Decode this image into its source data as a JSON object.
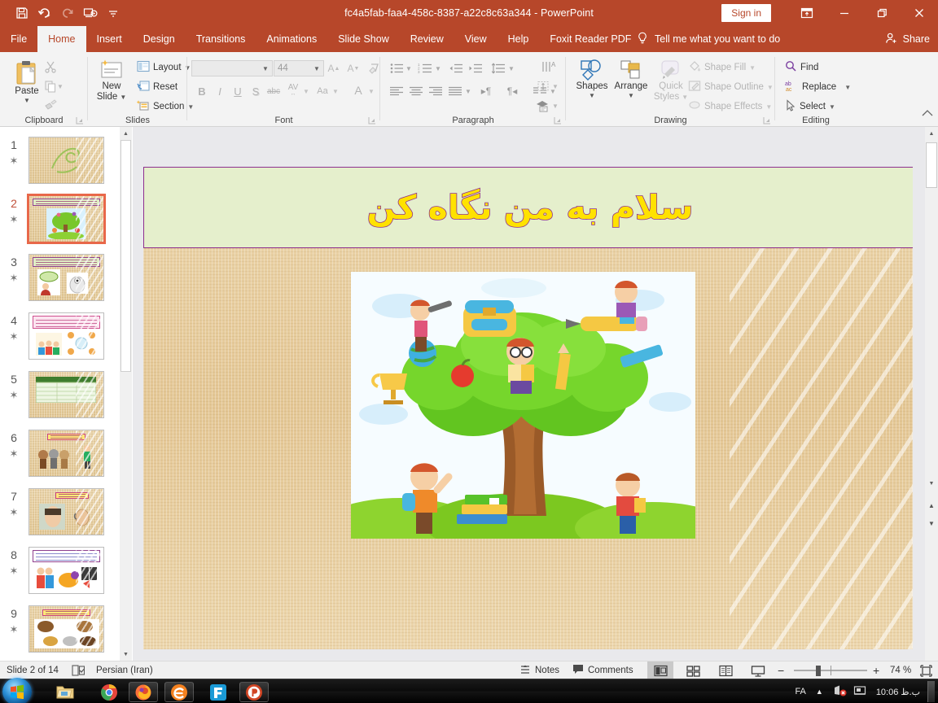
{
  "window": {
    "title": "fc4a5fab-faa4-458c-8387-a22c8c63a344  -  PowerPoint",
    "sign_in": "Sign in",
    "accent_color": "#b7472a",
    "quick_access": [
      {
        "name": "save-icon",
        "tooltip": "Save"
      },
      {
        "name": "undo-icon",
        "tooltip": "Undo"
      },
      {
        "name": "redo-icon",
        "tooltip": "Redo"
      },
      {
        "name": "start-from-beginning-icon",
        "tooltip": "Start From Beginning"
      },
      {
        "name": "customize-quick-access-toolbar-icon",
        "tooltip": "Customize Quick Access Toolbar"
      }
    ],
    "buttons": {
      "ribbon_display_options": "ribbon-display-options-icon",
      "minimize": "minimize-icon",
      "restore": "restore-icon",
      "close": "close-icon"
    }
  },
  "tabs": [
    {
      "label": "File",
      "active": false
    },
    {
      "label": "Home",
      "active": true
    },
    {
      "label": "Insert",
      "active": false
    },
    {
      "label": "Design",
      "active": false
    },
    {
      "label": "Transitions",
      "active": false
    },
    {
      "label": "Animations",
      "active": false
    },
    {
      "label": "Slide Show",
      "active": false
    },
    {
      "label": "Review",
      "active": false
    },
    {
      "label": "View",
      "active": false
    },
    {
      "label": "Help",
      "active": false
    },
    {
      "label": "Foxit Reader PDF",
      "active": false
    }
  ],
  "tell_me": "Tell me what you want to do",
  "share": "Share",
  "ribbon": {
    "clipboard": {
      "label": "Clipboard",
      "paste": "Paste",
      "cut": "Cut",
      "copy": "Copy",
      "format_painter": "Format Painter"
    },
    "slides": {
      "label": "Slides",
      "new_slide": "New\nSlide",
      "new_slide_line1": "New",
      "new_slide_line2": "Slide",
      "layout": "Layout",
      "reset": "Reset",
      "section": "Section"
    },
    "font": {
      "label": "Font",
      "font_name": "",
      "font_name_placeholder": "",
      "font_size": "44",
      "bold": "B",
      "italic": "I",
      "underline": "U",
      "shadow": "S",
      "strikethrough": "abc",
      "character_spacing": "AV",
      "change_case": "Aa",
      "font_color": "A"
    },
    "paragraph": {
      "label": "Paragraph"
    },
    "drawing": {
      "label": "Drawing",
      "shapes": "Shapes",
      "arrange": "Arrange",
      "quick_styles_line1": "Quick",
      "quick_styles_line2": "Styles",
      "shape_fill": "Shape Fill",
      "shape_outline": "Shape Outline",
      "shape_effects": "Shape Effects"
    },
    "editing": {
      "label": "Editing",
      "find": "Find",
      "replace": "Replace",
      "select": "Select"
    },
    "collapse": "collapse-ribbon-icon"
  },
  "thumbnails": [
    {
      "number": "1",
      "selected": false,
      "style": "plain",
      "title_bar": "none"
    },
    {
      "number": "2",
      "selected": true,
      "style": "tree",
      "title_bar": "green"
    },
    {
      "number": "3",
      "selected": false,
      "style": "two-pics",
      "title_bar": "green"
    },
    {
      "number": "4",
      "selected": false,
      "style": "two-pics",
      "title_bar": "pink"
    },
    {
      "number": "5",
      "selected": false,
      "style": "table",
      "title_bar": "none"
    },
    {
      "number": "6",
      "selected": false,
      "style": "two-pics",
      "title_bar": "yellow"
    },
    {
      "number": "7",
      "selected": false,
      "style": "two-pics",
      "title_bar": "yellow"
    },
    {
      "number": "8",
      "selected": false,
      "style": "three-pics",
      "title_bar": "white"
    },
    {
      "number": "9",
      "selected": false,
      "style": "animals",
      "title_bar": "yellow"
    }
  ],
  "slide": {
    "title": "سلام به من نگاه کن",
    "title_fill": "#e5efcc",
    "title_border": "#8e2f8e",
    "title_text_color": "#ffe200",
    "title_outline_color": "#8e2f8e",
    "picture_alt": "children-playing-around-tree-clipart"
  },
  "status": {
    "slide_counter": "Slide 2 of 14",
    "accessibility_icon": "accessibility-checker-icon",
    "language": "Persian (Iran)",
    "notes": "Notes",
    "comments": "Comments",
    "views": [
      {
        "name": "normal-view",
        "active": true
      },
      {
        "name": "slide-sorter-view",
        "active": false
      },
      {
        "name": "reading-view",
        "active": false
      },
      {
        "name": "slide-show-view",
        "active": false
      }
    ],
    "zoom_out": "−",
    "zoom_in": "+",
    "zoom_level": "74 %",
    "fit_to_window": "fit-slide-to-window-icon"
  },
  "taskbar": {
    "start": "start-button",
    "apps": [
      {
        "name": "file-explorer-icon",
        "running": false
      },
      {
        "name": "google-chrome-icon",
        "running": false
      },
      {
        "name": "firefox-icon",
        "running": true
      },
      {
        "name": "internet-browser-icon",
        "running": true
      },
      {
        "name": "foxit-reader-icon",
        "running": false
      },
      {
        "name": "powerpoint-icon",
        "running": true
      }
    ],
    "tray": {
      "language": "FA",
      "show_hidden_icons": "show-hidden-icons-icon",
      "network_icon": "network-disconnected-icon",
      "action_center_icon": "action-center-icon",
      "clock": "10:06 ب.ظ"
    }
  }
}
